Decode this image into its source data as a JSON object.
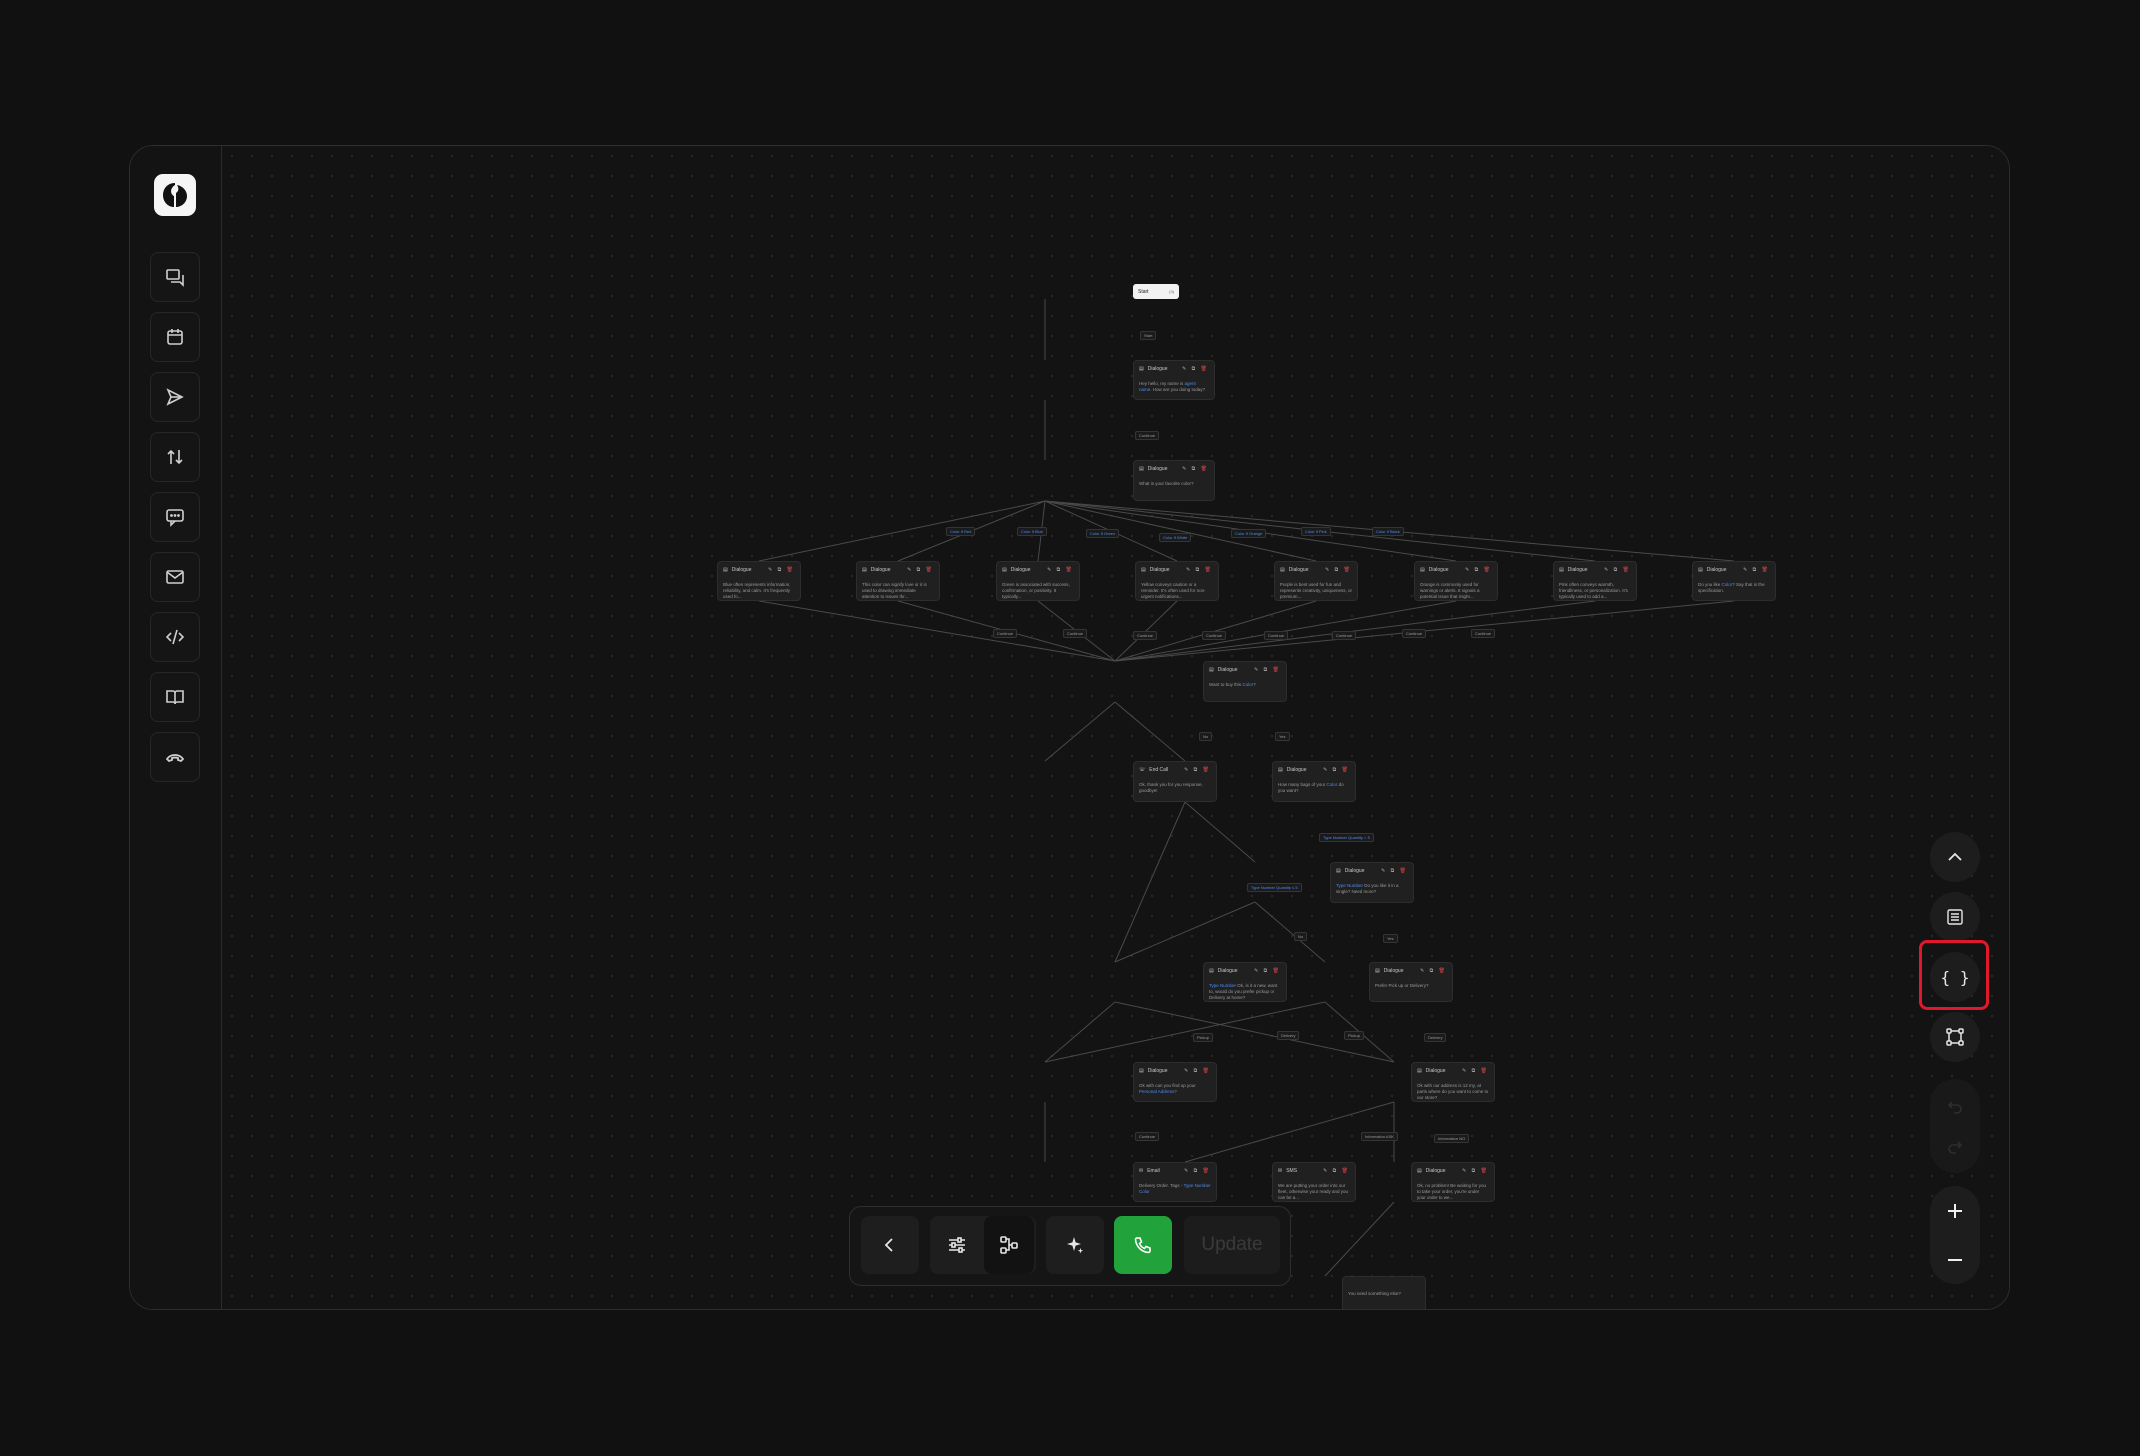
{
  "sidebar": {
    "logo": "logo-icon",
    "items": [
      {
        "name": "conversations-icon"
      },
      {
        "name": "calendar-icon"
      },
      {
        "name": "send-icon"
      },
      {
        "name": "transfer-icon"
      },
      {
        "name": "chat-icon"
      },
      {
        "name": "mail-icon"
      },
      {
        "name": "code-icon"
      },
      {
        "name": "book-icon"
      },
      {
        "name": "end-call-icon"
      }
    ]
  },
  "flow": {
    "start": {
      "label": "Start",
      "tag": "(3)"
    },
    "edge_start": "Start",
    "n1": {
      "title": "Dialogue",
      "body_pre": "Hey hello, my name is",
      "var": "agent name",
      "body_post": ". How are you doing today?"
    },
    "edge_n1": "Continue",
    "n2": {
      "title": "Dialogue",
      "body": "What is your favorite color?"
    },
    "branch_edges": [
      "Color  If Red",
      "Color  If Blue",
      "Color  If Green",
      "Color  If White",
      "Color  If Orange",
      "Color  If Pink",
      "Color  If Black"
    ],
    "branch_nodes": [
      {
        "title": "Dialogue",
        "body": "Blue often represents information, reliability, and calm. It's frequently used fo..."
      },
      {
        "title": "Dialogue",
        "body": "This color can signify love or it is used to drawing immediate attention to issues thr..."
      },
      {
        "title": "Dialogue",
        "body": "Green is associated with success, confirmation, or positivity. It typically..."
      },
      {
        "title": "Dialogue",
        "body": "Yellow conveys caution or a reminder. It's often used for non-urgent notifications..."
      },
      {
        "title": "Dialogue",
        "body": "Purple is best used for fun and represents creativity, uniqueness, or premium..."
      },
      {
        "title": "Dialogue",
        "body": "Orange is commonly used for warnings or alerts. It signals a potential issue that might..."
      },
      {
        "title": "Dialogue",
        "body": "Pink often conveys warmth, friendliness, or personalization. It's typically used to add a..."
      },
      {
        "title": "Dialogue",
        "body_pre": "Do you like",
        "var": "Color",
        "body_post": "? Say that is the specification."
      }
    ],
    "merge_edges": [
      "Continue",
      "Continue",
      "Continue",
      "Continue",
      "Continue",
      "Continue",
      "Continue",
      "Continue"
    ],
    "n3": {
      "title": "Dialogue",
      "body_pre": "Want to buy this",
      "var": "Color",
      "body_post": "?"
    },
    "edge_no": "No",
    "edge_yes": "Yes",
    "n_end1": {
      "title": "End Call",
      "body": "Ok, thank you for you response, goodbye!"
    },
    "n4": {
      "title": "Dialogue",
      "body_pre": "How many bags of your",
      "var": "Color",
      "body_post": "do you want?"
    },
    "edge_n4_right": "Type Number  Quantity > 5",
    "edge_n4_left": "Type Number  Quantity ≤ 5",
    "n5": {
      "title": "Dialogue",
      "var": "Type Number",
      "body_post": "Do you like it in a single? Need more?"
    },
    "edge_n5_no": "No",
    "edge_n5_yes": "Yes",
    "n6": {
      "title": "Dialogue",
      "var": "Type Number",
      "body_post": "Ok, is it a new, want to, would do you prefer pickup or Delivery at home?"
    },
    "n7": {
      "title": "Dialogue",
      "body": "Prefer Pick up or Delivery?"
    },
    "cross_edges": [
      "Pickup",
      "Delivery",
      "Pickup",
      "Delivery"
    ],
    "n8": {
      "title": "Dialogue",
      "body_pre": "Ok with can you find up your",
      "var": "Personal Address",
      "body_post": "?"
    },
    "n9": {
      "title": "Dialogue",
      "body": "Ok with our address is 12 my, at parts where do you want to come to our store?"
    },
    "edge_n8": "Continue",
    "edge_n9_left": "Information ASK",
    "edge_n9_right": "Information NO",
    "n10": {
      "title": "Email",
      "body_pre": "Delivery Order. Tags -",
      "var": "Type Number",
      "body_post": "Color"
    },
    "n11": {
      "title": "SMS",
      "body": "We are putting your order into our fleet, otherwise your ready and you can be a..."
    },
    "n12": {
      "title": "Dialogue",
      "body": "Ok, no problem! Be waiting for you to take your order, you're under your order to we..."
    },
    "n13": {
      "body": "You need something else?"
    }
  },
  "right_controls": [
    "chevron-up-icon",
    "document-icon",
    "braces-icon",
    "nodes-icon",
    "undo-icon",
    "redo-icon",
    "plus-icon",
    "minus-icon"
  ],
  "toolbar": {
    "update_label": "Update"
  }
}
